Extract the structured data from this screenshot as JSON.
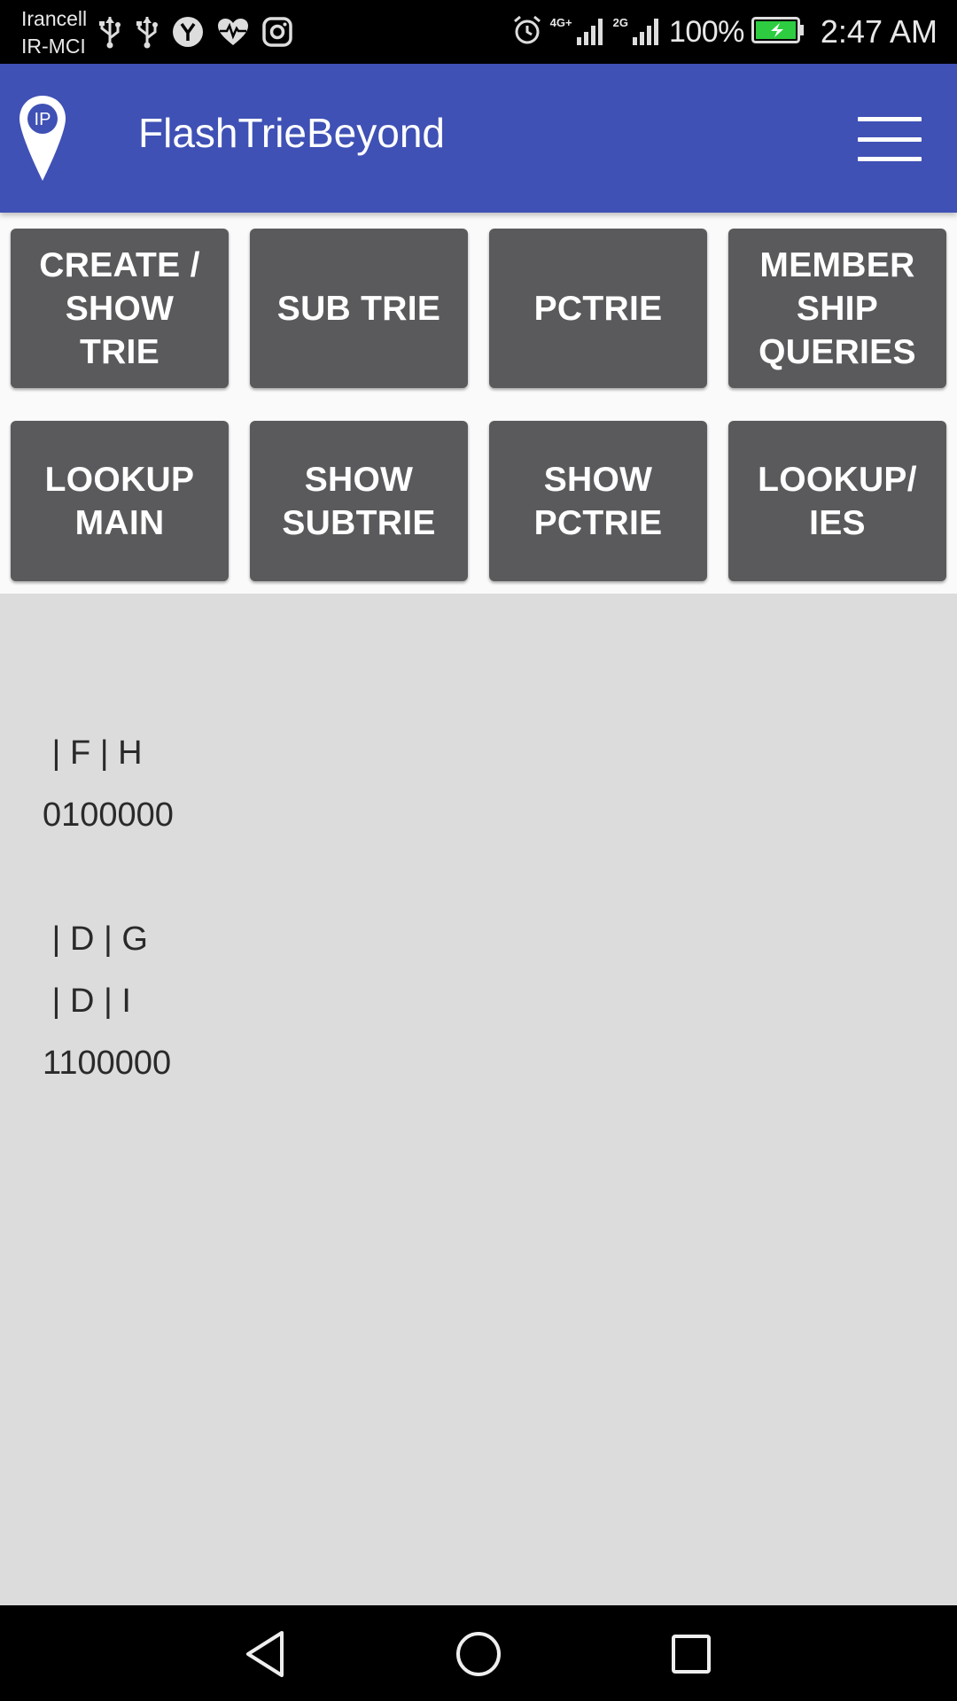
{
  "status_bar": {
    "carrier_1": "Irancell",
    "carrier_2": "IR-MCI",
    "left_icons": [
      "usb-icon",
      "usb-icon",
      "y-app-icon",
      "heart-rate-icon",
      "instagram-icon"
    ],
    "network_1": "4G+",
    "network_2": "2G",
    "battery_percent": "100%",
    "time": "2:47 AM"
  },
  "app_bar": {
    "logo_text": "IP",
    "title": "FlashTrieBeyond"
  },
  "buttons": {
    "create_show_trie": "CREATE /\nSHOW\nTRIE",
    "sub_trie": "SUB TRIE",
    "pctrie": "PCTRIE",
    "membership_queries": "MEMBER\nSHIP\nQUERIES",
    "lookup_main": "LOOKUP\nMAIN",
    "show_subtrie": "SHOW\nSUBTRIE",
    "show_pctrie": "SHOW\nPCTRIE",
    "lookup_ies": "LOOKUP/\nIES"
  },
  "output": {
    "lines": [
      " | F | H",
      "0100000",
      "",
      " | D | G",
      " | D | I",
      "1100000"
    ]
  },
  "colors": {
    "app_bar": "#3f51b5",
    "button": "#5a5a5c",
    "output_background": "#dcdcdc",
    "battery_fill": "#2ecc40"
  }
}
